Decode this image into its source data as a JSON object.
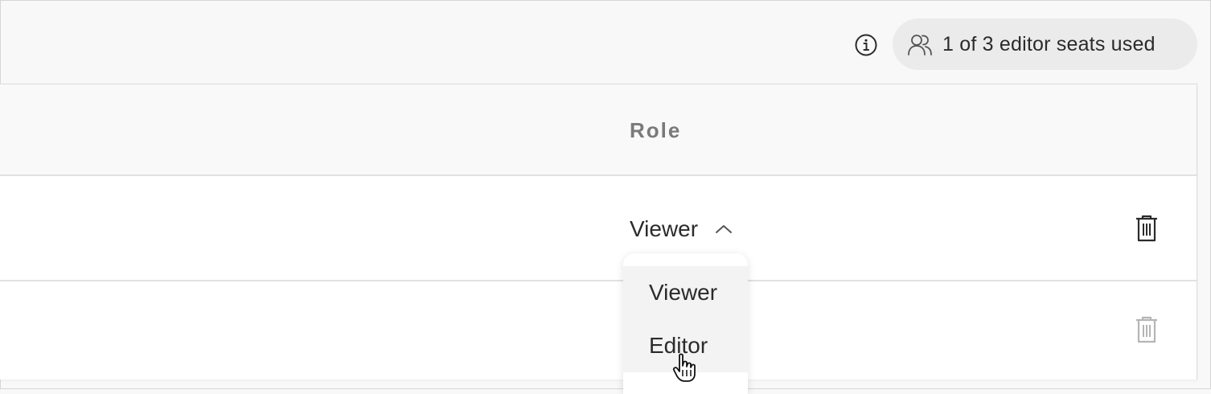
{
  "header": {
    "seats_label": "1 of 3 editor seats used",
    "info_icon": "info-circle-icon",
    "users_icon": "users-icon"
  },
  "table": {
    "columns": {
      "role": "Role"
    },
    "rows": [
      {
        "role": "Viewer",
        "dropdown_open": true,
        "delete_enabled": true
      },
      {
        "role": "",
        "delete_enabled": false
      }
    ]
  },
  "dropdown": {
    "options": [
      "Viewer",
      "Editor"
    ],
    "hovered": "Editor"
  },
  "colors": {
    "page_bg": "#f8f8f8",
    "pill_bg": "#ebebeb",
    "header_text": "#7a7a7a",
    "disabled_icon": "#b5b5b5"
  }
}
